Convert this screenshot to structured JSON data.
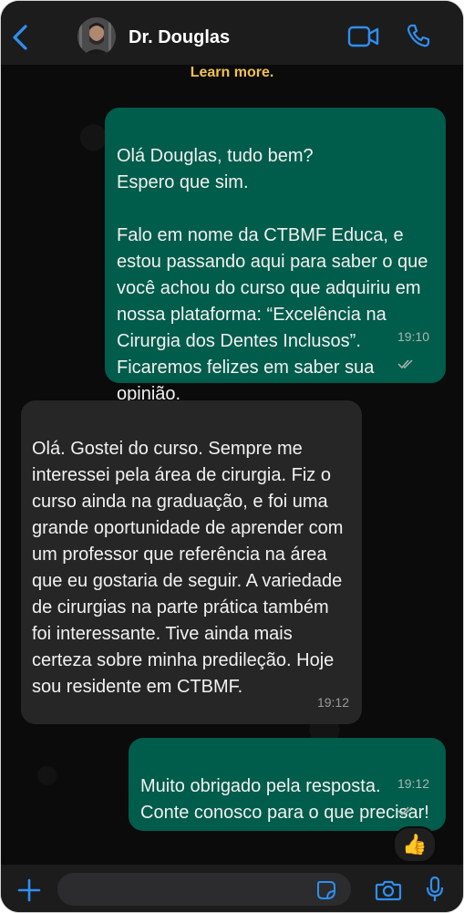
{
  "header": {
    "contact_name": "Dr. Douglas"
  },
  "notice": {
    "text": "Learn more."
  },
  "messages": [
    {
      "direction": "outgoing",
      "text": "Olá Douglas, tudo bem?\nEspero que sim.\n\nFalo em nome da CTBMF Educa, e estou passando aqui para saber o que você achou do curso que adquiriu em nossa plataforma: “Excelência na Cirurgia dos Dentes Inclusos”. Ficaremos felizes em saber sua opinião.",
      "time": "19:10",
      "status": "read"
    },
    {
      "direction": "incoming",
      "text": "Olá. Gostei do curso. Sempre me interessei pela área de cirurgia. Fiz o curso ainda na graduação, e foi uma grande oportunidade de aprender com um professor que referência na área que eu gostaria de seguir. A variedade de cirurgias na parte prática também foi interessante. Tive ainda mais certeza sobre minha predileção. Hoje sou residente em CTBMF.",
      "time": "19:12"
    },
    {
      "direction": "outgoing",
      "text": "Muito obrigado pela resposta. Conte conosco para o que precisar!",
      "time": "19:12",
      "status": "read",
      "reaction": "👍"
    }
  ],
  "composer": {
    "value": ""
  },
  "colors": {
    "outgoing_bubble": "#005c4b",
    "incoming_bubble": "#262626",
    "accent": "#2f8ff0",
    "notice": "#f2c14e"
  },
  "icons": [
    "back-chevron-icon",
    "video-call-icon",
    "phone-call-icon",
    "plus-icon",
    "sticker-icon",
    "camera-icon",
    "microphone-icon",
    "double-check-icon"
  ]
}
